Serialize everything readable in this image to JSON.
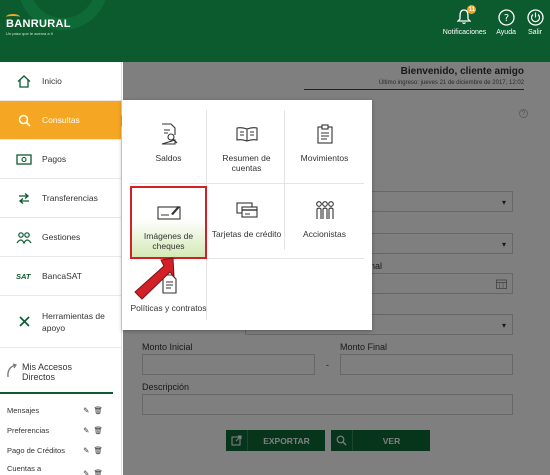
{
  "header": {
    "brand": "BANRURAL",
    "tagline": "Un paso que te acerca a ti",
    "notification_count": "11",
    "actions": [
      {
        "label": "Notificaciones",
        "icon": "bell-icon"
      },
      {
        "label": "Ayuda",
        "icon": "help-icon"
      },
      {
        "label": "Salir",
        "icon": "power-icon"
      }
    ]
  },
  "sidebar": {
    "items": [
      {
        "label": "Inicio",
        "icon": "home-icon"
      },
      {
        "label": "Consultas",
        "icon": "search-icon",
        "active": true
      },
      {
        "label": "Pagos",
        "icon": "money-icon"
      },
      {
        "label": "Transferencias",
        "icon": "transfer-icon"
      },
      {
        "label": "Gestiones",
        "icon": "people-icon"
      },
      {
        "label": "BancaSAT",
        "icon": "sat-icon"
      },
      {
        "label": "Herramientas de apoyo",
        "icon": "tools-icon"
      }
    ],
    "accesos_title": "Mis Accesos Directos",
    "quick": [
      {
        "label": "Mensajes"
      },
      {
        "label": "Preferencias"
      },
      {
        "label": "Pago de Créditos"
      },
      {
        "label": "Cuentas a Terceros"
      }
    ]
  },
  "main": {
    "welcome": "Bienvenido, cliente amigo",
    "last_login": "Último ingreso: jueves 21 de diciembre de 2017, 12:02",
    "labels": {
      "fecha_final": "nal",
      "monto_inicial": "Monto Inicial",
      "monto_final": "Monto Final",
      "descripcion": "Descripción",
      "dash": "-"
    },
    "buttons": {
      "exportar": "EXPORTAR",
      "ver": "VER"
    }
  },
  "menu": {
    "items": [
      {
        "label": "Saldos",
        "icon": "document-search-icon"
      },
      {
        "label": "Resumen de cuentas",
        "icon": "book-icon"
      },
      {
        "label": "Movimientos",
        "icon": "clipboard-icon"
      },
      {
        "label": "Imágenes de cheques",
        "icon": "check-image-icon",
        "selected": true
      },
      {
        "label": "Tarjetas de crédito",
        "icon": "credit-card-icon"
      },
      {
        "label": "Accionistas",
        "icon": "shareholders-icon"
      },
      {
        "label": "Políticas y contratos",
        "icon": "contract-icon"
      }
    ]
  },
  "colors": {
    "brand_green": "#0b5b2e",
    "accent_orange": "#f5a623",
    "selection_red": "#d31f26"
  }
}
